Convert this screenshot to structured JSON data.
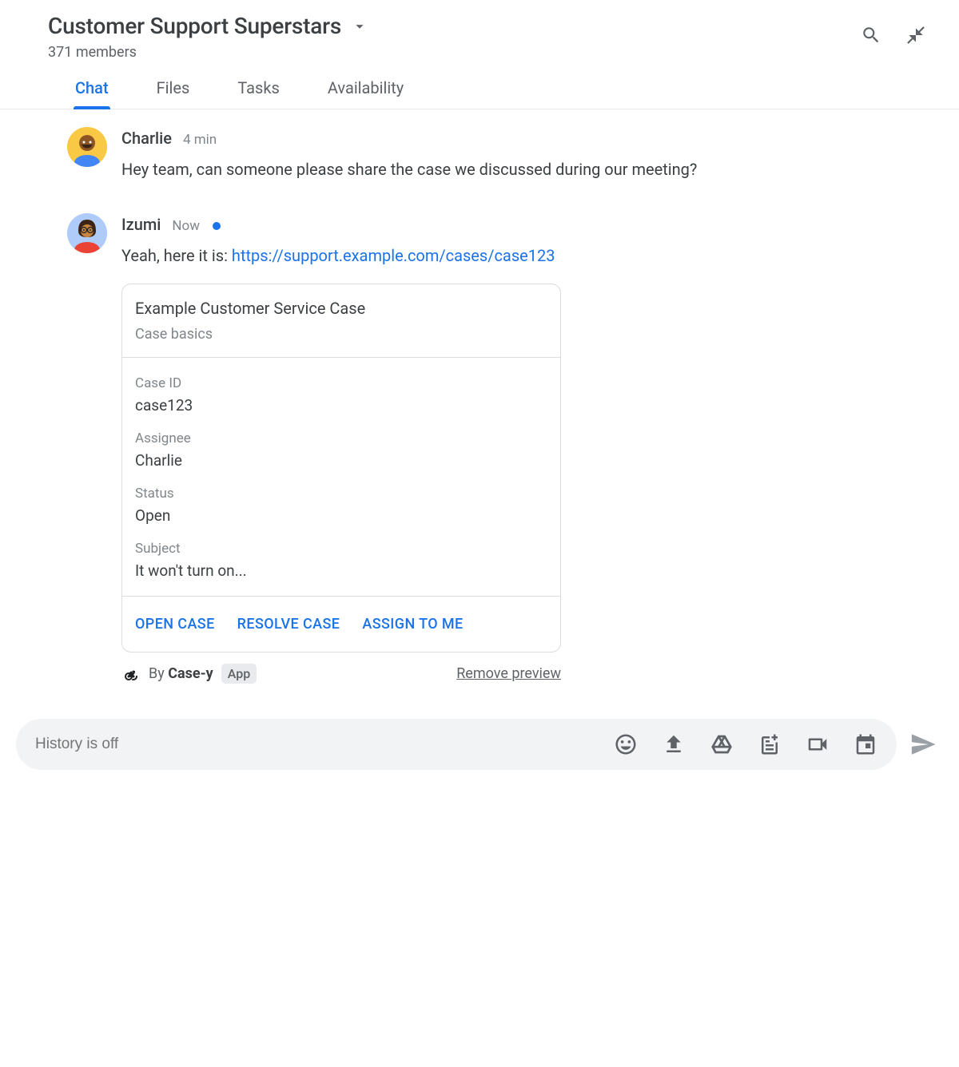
{
  "header": {
    "title": "Customer Support Superstars",
    "members": "371 members"
  },
  "tabs": [
    {
      "label": "Chat",
      "active": true
    },
    {
      "label": "Files",
      "active": false
    },
    {
      "label": "Tasks",
      "active": false
    },
    {
      "label": "Availability",
      "active": false
    }
  ],
  "messages": [
    {
      "name": "Charlie",
      "time": "4 min",
      "text": "Hey team, can someone please share the case we discussed during our meeting?"
    },
    {
      "name": "Izumi",
      "time": "Now",
      "status_dot": true,
      "text_prefix": "Yeah, here it is: ",
      "link": "https://support.example.com/cases/case123"
    }
  ],
  "card": {
    "title": "Example Customer Service Case",
    "subtitle": "Case basics",
    "fields": [
      {
        "label": "Case ID",
        "value": "case123"
      },
      {
        "label": "Assignee",
        "value": "Charlie"
      },
      {
        "label": "Status",
        "value": "Open"
      },
      {
        "label": "Subject",
        "value": "It won't turn on..."
      }
    ],
    "actions": [
      {
        "label": "OPEN CASE"
      },
      {
        "label": "RESOLVE CASE"
      },
      {
        "label": "ASSIGN TO ME"
      }
    ],
    "footer": {
      "by": "By",
      "app_name": "Case-y",
      "badge": "App",
      "remove": "Remove preview"
    }
  },
  "composer": {
    "placeholder": "History is off"
  }
}
